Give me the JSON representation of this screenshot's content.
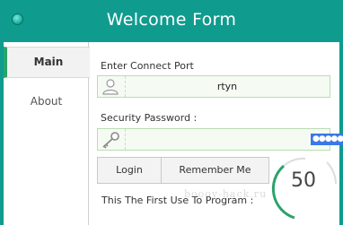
{
  "window": {
    "title": "Welcome Form"
  },
  "sidebar": {
    "tabs": [
      {
        "label": "Main",
        "selected": true
      },
      {
        "label": "About",
        "selected": false
      }
    ]
  },
  "form": {
    "port_label": "Enter Connect Port",
    "port_value": "rtyn",
    "password_label": "Security Password :",
    "password_value": "●●●●●"
  },
  "buttons": {
    "login": "Login",
    "remember": "Remember Me"
  },
  "footer": {
    "first_use_text": "This The First Use To Program :"
  },
  "gauge": {
    "value": "50"
  },
  "watermark": "boooy-hack.ru",
  "colors": {
    "accent": "#0f9c8f",
    "selected_tab": "#2aa36a",
    "gauge": "#2aa36a",
    "selection": "#3b78e7"
  }
}
